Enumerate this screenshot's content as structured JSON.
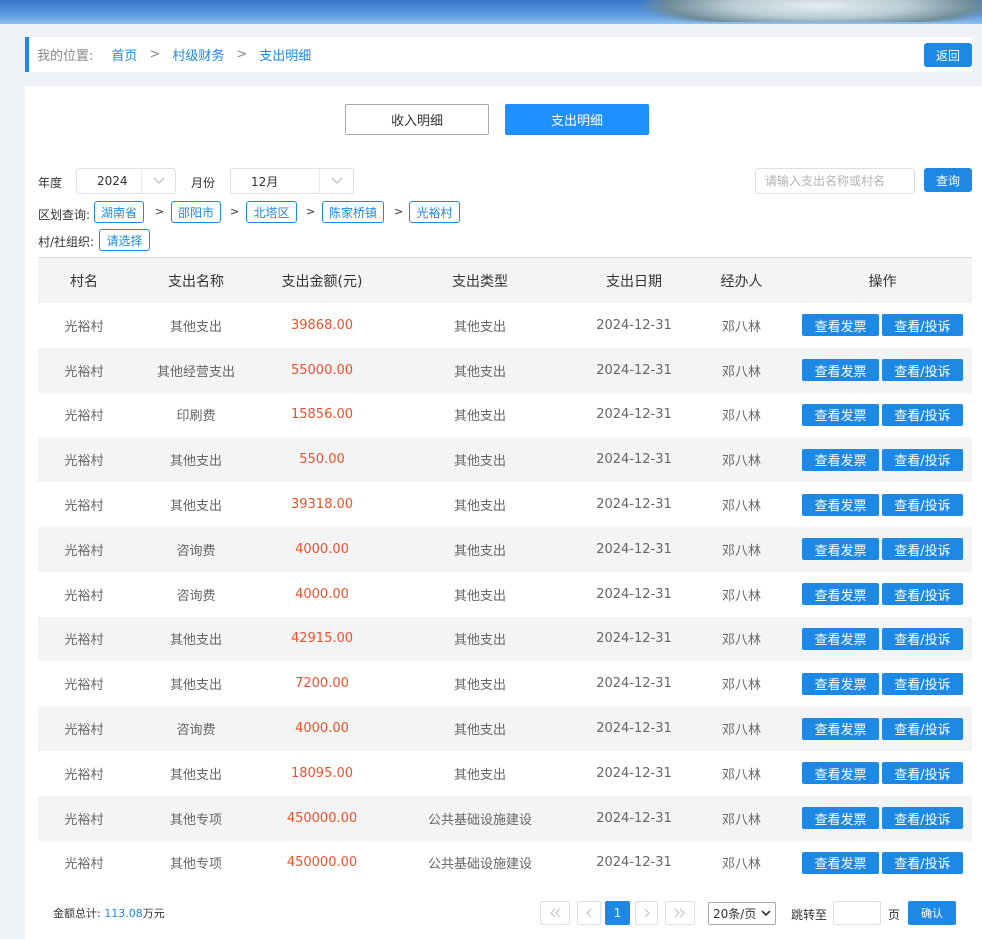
{
  "breadcrumb": {
    "label": "我的位置:",
    "items": [
      "首页",
      "村级财务",
      "支出明细"
    ],
    "separator": ">",
    "back_label": "返回"
  },
  "tabs": {
    "income": "收入明细",
    "expense": "支出明细",
    "active": "expense"
  },
  "filters": {
    "year_label": "年度",
    "year_value": "2024",
    "month_label": "月份",
    "month_value": "12月",
    "search_placeholder": "请输入支出名称或村名",
    "search_button": "查询",
    "region_label": "区划查询:",
    "region_path": [
      "湖南省",
      "邵阳市",
      "北塔区",
      "陈家桥镇",
      "光裕村"
    ],
    "region_separator": ">",
    "org_label": "村/社组织:",
    "org_value": "请选择"
  },
  "table": {
    "headers": [
      "村名",
      "支出名称",
      "支出金额(元)",
      "支出类型",
      "支出日期",
      "经办人",
      "操作"
    ],
    "action_invoice": "查看发票",
    "action_complaint": "查看/投诉",
    "rows": [
      [
        "光裕村",
        "其他支出",
        "39868.00",
        "其他支出",
        "2024-12-31",
        "邓八林"
      ],
      [
        "光裕村",
        "其他经营支出",
        "55000.00",
        "其他支出",
        "2024-12-31",
        "邓八林"
      ],
      [
        "光裕村",
        "印刷费",
        "15856.00",
        "其他支出",
        "2024-12-31",
        "邓八林"
      ],
      [
        "光裕村",
        "其他支出",
        "550.00",
        "其他支出",
        "2024-12-31",
        "邓八林"
      ],
      [
        "光裕村",
        "其他支出",
        "39318.00",
        "其他支出",
        "2024-12-31",
        "邓八林"
      ],
      [
        "光裕村",
        "咨询费",
        "4000.00",
        "其他支出",
        "2024-12-31",
        "邓八林"
      ],
      [
        "光裕村",
        "咨询费",
        "4000.00",
        "其他支出",
        "2024-12-31",
        "邓八林"
      ],
      [
        "光裕村",
        "其他支出",
        "42915.00",
        "其他支出",
        "2024-12-31",
        "邓八林"
      ],
      [
        "光裕村",
        "其他支出",
        "7200.00",
        "其他支出",
        "2024-12-31",
        "邓八林"
      ],
      [
        "光裕村",
        "咨询费",
        "4000.00",
        "其他支出",
        "2024-12-31",
        "邓八林"
      ],
      [
        "光裕村",
        "其他支出",
        "18095.00",
        "其他支出",
        "2024-12-31",
        "邓八林"
      ],
      [
        "光裕村",
        "其他专项",
        "450000.00",
        "公共基础设施建设",
        "2024-12-31",
        "邓八林"
      ],
      [
        "光裕村",
        "其他专项",
        "450000.00",
        "公共基础设施建设",
        "2024-12-31",
        "邓八林"
      ]
    ]
  },
  "footer": {
    "total_label": "金额总计:",
    "total_value": "113.08",
    "total_unit": "万元",
    "current_page": "1",
    "page_size": "20条/页",
    "jump_label": "跳转至",
    "page_unit": "页",
    "confirm_label": "确认"
  },
  "colors": {
    "accent": "#1e88e5",
    "amount": "#f0502a"
  }
}
